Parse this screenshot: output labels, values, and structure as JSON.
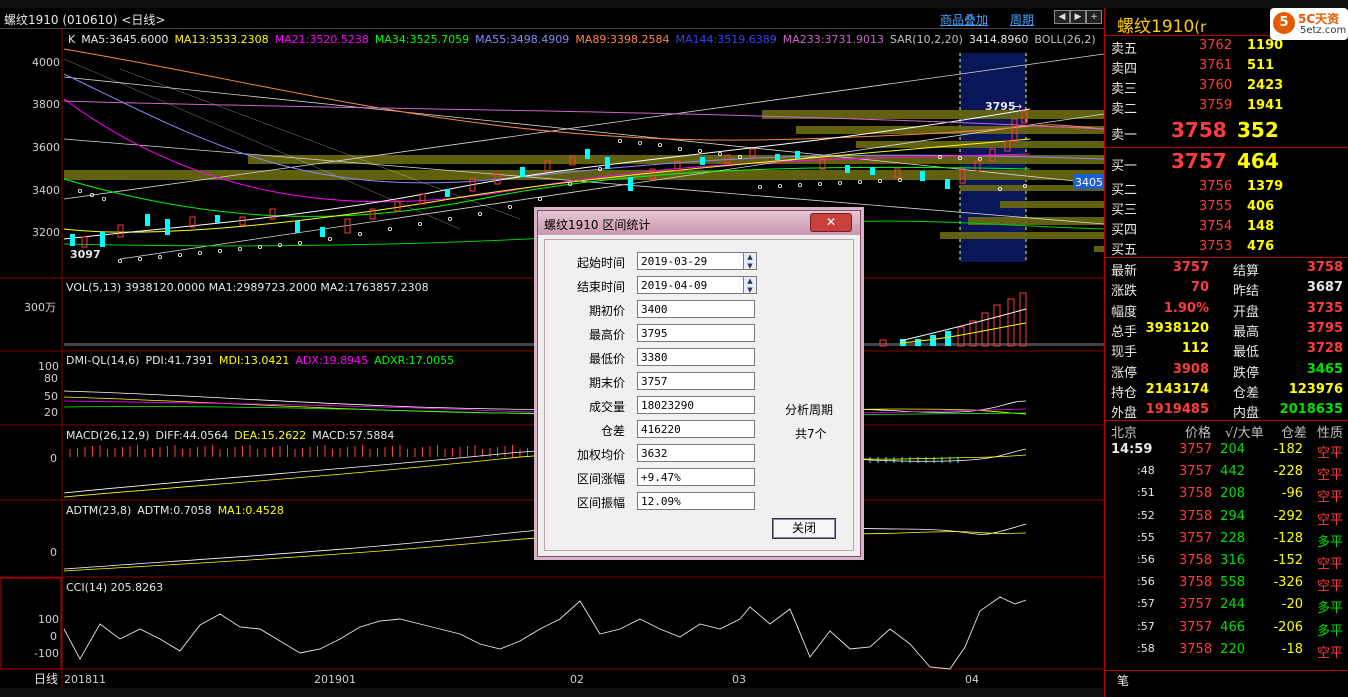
{
  "title_bar": {
    "symbol_label": "螺纹1910 (010610) <日线>",
    "overlay_link": "商品叠加",
    "period_link": "周期"
  },
  "main_panel": {
    "ma_line": [
      {
        "text": "K",
        "color": "#e8e8e8"
      },
      {
        "text": "MA5:3645.6000",
        "color": "#e8e8e8"
      },
      {
        "text": "MA13:3533.2308",
        "color": "#ffff00"
      },
      {
        "text": "MA21:3520.5238",
        "color": "#ff00ff"
      },
      {
        "text": "MA34:3525.7059",
        "color": "#00ff00"
      },
      {
        "text": "MA55:3498.4909",
        "color": "#8888ff"
      },
      {
        "text": "MA89:3398.2584",
        "color": "#ff8844"
      },
      {
        "text": "MA144:3519.6389",
        "color": "#3344ff"
      },
      {
        "text": "MA233:3731.9013",
        "color": "#cc66cc"
      },
      {
        "text": "SAR(10,2,20)",
        "color": "#c0c0c0"
      },
      {
        "text": "3414.8960",
        "color": "#e8e8e8"
      },
      {
        "text": "BOLL(26,2)",
        "color": "#c0c0c0"
      }
    ],
    "yticks": [
      "4000",
      "3800",
      "3600",
      "3400",
      "3200"
    ],
    "low_label": "3097",
    "high_label": "3795",
    "price_box": "3405"
  },
  "vol_panel": {
    "title": "VOL(5,13) 3938120.0000 MA1:2989723.2000 MA2:1763857.2308",
    "ytick": "300万"
  },
  "dmi_panel": {
    "title_parts": [
      {
        "text": "DMI-QL(14,6)",
        "color": "#e8e8e8"
      },
      {
        "text": "PDI:41.7391",
        "color": "#e8e8e8"
      },
      {
        "text": "MDI:13.0421",
        "color": "#ffff00"
      },
      {
        "text": "ADX:19.8945",
        "color": "#ff00ff"
      },
      {
        "text": "ADXR:17.0055",
        "color": "#00ff00"
      }
    ],
    "yticks": [
      "100",
      "80",
      "50",
      "20"
    ]
  },
  "macd_panel": {
    "title_parts": [
      {
        "text": "MACD(26,12,9)",
        "color": "#e8e8e8"
      },
      {
        "text": "DIFF:44.0564",
        "color": "#e8e8e8"
      },
      {
        "text": "DEA:15.2622",
        "color": "#ffff00"
      },
      {
        "text": "MACD:57.5884",
        "color": "#e8e8e8"
      }
    ],
    "ytick": "0"
  },
  "adtm_panel": {
    "title_parts": [
      {
        "text": "ADTM(23,8)",
        "color": "#e8e8e8"
      },
      {
        "text": "ADTM:0.7058",
        "color": "#e8e8e8"
      },
      {
        "text": "MA1:0.4528",
        "color": "#ffff00"
      }
    ],
    "ytick": "0"
  },
  "cci_panel": {
    "title": "CCI(14) 205.8263",
    "yticks": [
      "100",
      "0",
      "-100"
    ]
  },
  "x_axis": {
    "period": "日线",
    "labels": [
      "201811",
      "201901",
      "02",
      "03",
      "04"
    ]
  },
  "dialog": {
    "title": "螺纹1910 区间统计",
    "close_x": "✕",
    "fields": [
      {
        "label": "起始时间",
        "value": "2019-03-29"
      },
      {
        "label": "结束时间",
        "value": "2019-04-09"
      },
      {
        "label": "期初价",
        "value": "3400"
      },
      {
        "label": "最高价",
        "value": "3795"
      },
      {
        "label": "最低价",
        "value": "3380"
      },
      {
        "label": "期末价",
        "value": "3757"
      },
      {
        "label": "成交量",
        "value": "18023290"
      },
      {
        "label": "仓差",
        "value": "416220"
      },
      {
        "label": "加权均价",
        "value": "3632"
      },
      {
        "label": "区间涨幅",
        "value": "+9.47%"
      },
      {
        "label": "区间振幅",
        "value": "12.09%"
      }
    ],
    "period_label": "分析周期",
    "period_value": "共7个",
    "close_button": "关闭"
  },
  "right_panel": {
    "name": "螺纹1910",
    "name_suffix": "(r",
    "logo_char": "5",
    "logo_text": "5C天资",
    "logo_url": "5etz.com",
    "asks": [
      {
        "label": "卖五",
        "price": "3762",
        "vol": "1190"
      },
      {
        "label": "卖四",
        "price": "3761",
        "vol": "511"
      },
      {
        "label": "卖三",
        "price": "3760",
        "vol": "2423"
      },
      {
        "label": "卖二",
        "price": "3759",
        "vol": "1941"
      },
      {
        "label": "卖一",
        "price": "3758",
        "vol": "352"
      }
    ],
    "bids": [
      {
        "label": "买一",
        "price": "3757",
        "vol": "464"
      },
      {
        "label": "买二",
        "price": "3756",
        "vol": "1379"
      },
      {
        "label": "买三",
        "price": "3755",
        "vol": "406"
      },
      {
        "label": "买四",
        "price": "3754",
        "vol": "148"
      },
      {
        "label": "买五",
        "price": "3753",
        "vol": "476"
      }
    ],
    "stats": [
      {
        "l1": "最新",
        "v1": "3757",
        "c1": "#ff3b3b",
        "l2": "结算",
        "v2": "3758",
        "c2": "#ff3b3b"
      },
      {
        "l1": "涨跌",
        "v1": "70",
        "c1": "#ff3b3b",
        "l2": "昨结",
        "v2": "3687",
        "c2": "#e8e8e8"
      },
      {
        "l1": "幅度",
        "v1": "1.90%",
        "c1": "#ff3b3b",
        "l2": "开盘",
        "v2": "3735",
        "c2": "#ff3b3b"
      },
      {
        "l1": "总手",
        "v1": "3938120",
        "c1": "#ffff00",
        "l2": "最高",
        "v2": "3795",
        "c2": "#ff3b3b"
      },
      {
        "l1": "现手",
        "v1": "112",
        "c1": "#ffff00",
        "l2": "最低",
        "v2": "3728",
        "c2": "#ff3b3b"
      },
      {
        "l1": "涨停",
        "v1": "3908",
        "c1": "#ff3b3b",
        "l2": "跌停",
        "v2": "3465",
        "c2": "#00e000"
      },
      {
        "l1": "持仓",
        "v1": "2143174",
        "c1": "#ffff00",
        "l2": "仓差",
        "v2": "123976",
        "c2": "#ffff00"
      },
      {
        "l1": "外盘",
        "v1": "1919485",
        "c1": "#ff3b3b",
        "l2": "内盘",
        "v2": "2018635",
        "c2": "#00e000"
      }
    ],
    "tick_header": {
      "region": "北京",
      "price": "价格",
      "vol": "√/大单",
      "oi": "仓差",
      "nature": "性质"
    },
    "ticks": [
      {
        "time": "14:59",
        "price": "3757",
        "vol": "204",
        "oi": "-182",
        "nature": "空平",
        "nc": "#ff3b3b"
      },
      {
        "time": ":48",
        "price": "3757",
        "vol": "442",
        "oi": "-228",
        "nature": "空平",
        "nc": "#ff3b3b"
      },
      {
        "time": ":51",
        "price": "3758",
        "vol": "208",
        "oi": "-96",
        "nature": "空平",
        "nc": "#ff3b3b"
      },
      {
        "time": ":52",
        "price": "3758",
        "vol": "294",
        "oi": "-292",
        "nature": "空平",
        "nc": "#ff3b3b"
      },
      {
        "time": ":55",
        "price": "3757",
        "vol": "228",
        "oi": "-128",
        "nature": "多平",
        "nc": "#00e000"
      },
      {
        "time": ":56",
        "price": "3758",
        "vol": "316",
        "oi": "-152",
        "nature": "空平",
        "nc": "#ff3b3b"
      },
      {
        "time": ":56",
        "price": "3758",
        "vol": "558",
        "oi": "-326",
        "nature": "空平",
        "nc": "#ff3b3b"
      },
      {
        "time": ":57",
        "price": "3757",
        "vol": "244",
        "oi": "-20",
        "nature": "多平",
        "nc": "#00e000"
      },
      {
        "time": ":57",
        "price": "3757",
        "vol": "466",
        "oi": "-206",
        "nature": "多平",
        "nc": "#00e000"
      },
      {
        "time": ":58",
        "price": "3758",
        "vol": "220",
        "oi": "-18",
        "nature": "空平",
        "nc": "#ff3b3b"
      }
    ],
    "bottom_tab": "笔"
  }
}
